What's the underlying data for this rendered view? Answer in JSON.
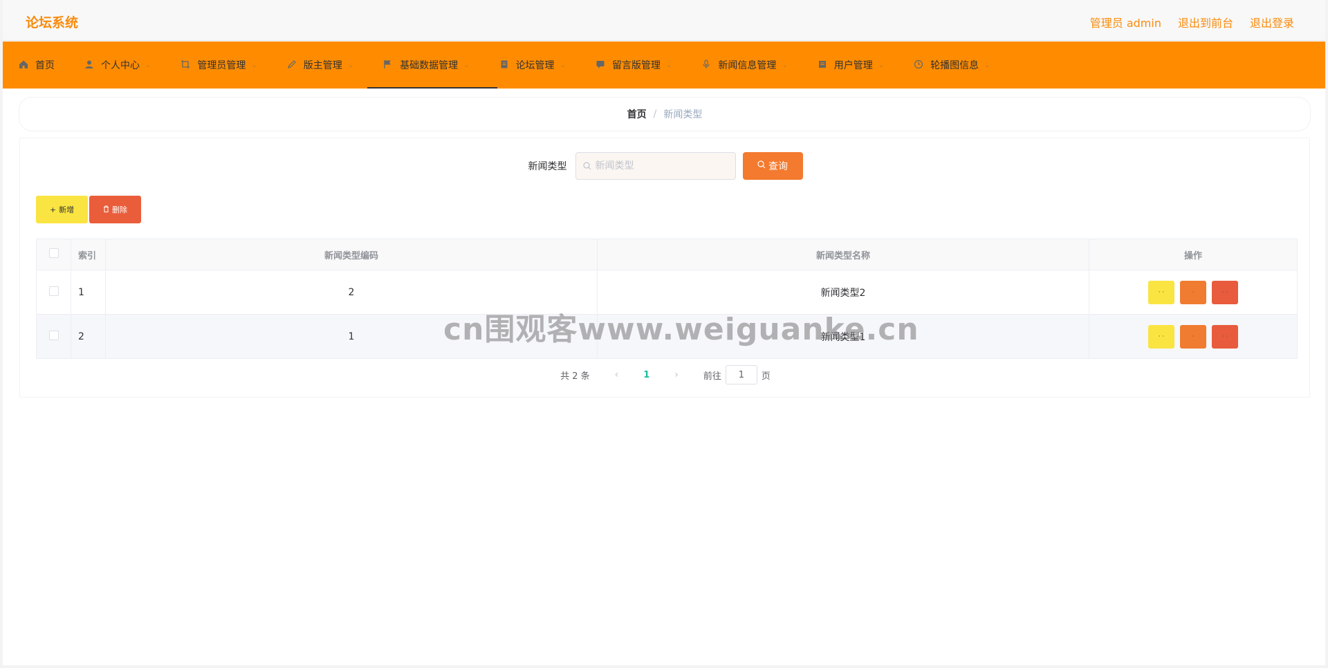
{
  "header": {
    "brand": "论坛系统",
    "user": "管理员 admin",
    "to_front": "退出到前台",
    "logout": "退出登录"
  },
  "nav": {
    "items": [
      {
        "label": "首页",
        "icon": "home-icon",
        "has_caret": false
      },
      {
        "label": "个人中心",
        "icon": "user-icon",
        "has_caret": true
      },
      {
        "label": "管理员管理",
        "icon": "crop-icon",
        "has_caret": true
      },
      {
        "label": "版主管理",
        "icon": "edit-icon",
        "has_caret": true
      },
      {
        "label": "基础数据管理",
        "icon": "flag-icon",
        "has_caret": true,
        "active": true
      },
      {
        "label": "论坛管理",
        "icon": "document-icon",
        "has_caret": true
      },
      {
        "label": "留言版管理",
        "icon": "message-icon",
        "has_caret": true
      },
      {
        "label": "新闻信息管理",
        "icon": "microphone-icon",
        "has_caret": true
      },
      {
        "label": "用户管理",
        "icon": "document-icon",
        "has_caret": true
      },
      {
        "label": "轮播图信息",
        "icon": "clock-icon",
        "has_caret": true
      }
    ]
  },
  "breadcrumb": {
    "home": "首页",
    "separator": "/",
    "current": "新闻类型"
  },
  "search": {
    "label": "新闻类型",
    "placeholder": "新闻类型",
    "button": "查询"
  },
  "actions": {
    "add": "新增",
    "delete": "删除"
  },
  "table": {
    "headers": [
      "索引",
      "新闻类型编码",
      "新闻类型名称",
      "操作"
    ],
    "rows": [
      {
        "index": "1",
        "code": "2",
        "name": "新闻类型2"
      },
      {
        "index": "2",
        "code": "1",
        "name": "新闻类型1"
      }
    ],
    "op_labels": {
      "view": "· ·",
      "edit": "·",
      "del": "· ·"
    }
  },
  "pagination": {
    "total": "共 2 条",
    "prev": "‹",
    "current_page": "1",
    "next": "›",
    "goto_label": "前往",
    "goto_value": "1",
    "page_suffix": "页"
  },
  "watermark": "cn围观客www.weiguanke.cn",
  "colors": {
    "brand": "#f98b0c",
    "nav_bg": "#ff8c00",
    "query": "#f37a2e",
    "add": "#fae442",
    "delete": "#ea5d3b"
  }
}
